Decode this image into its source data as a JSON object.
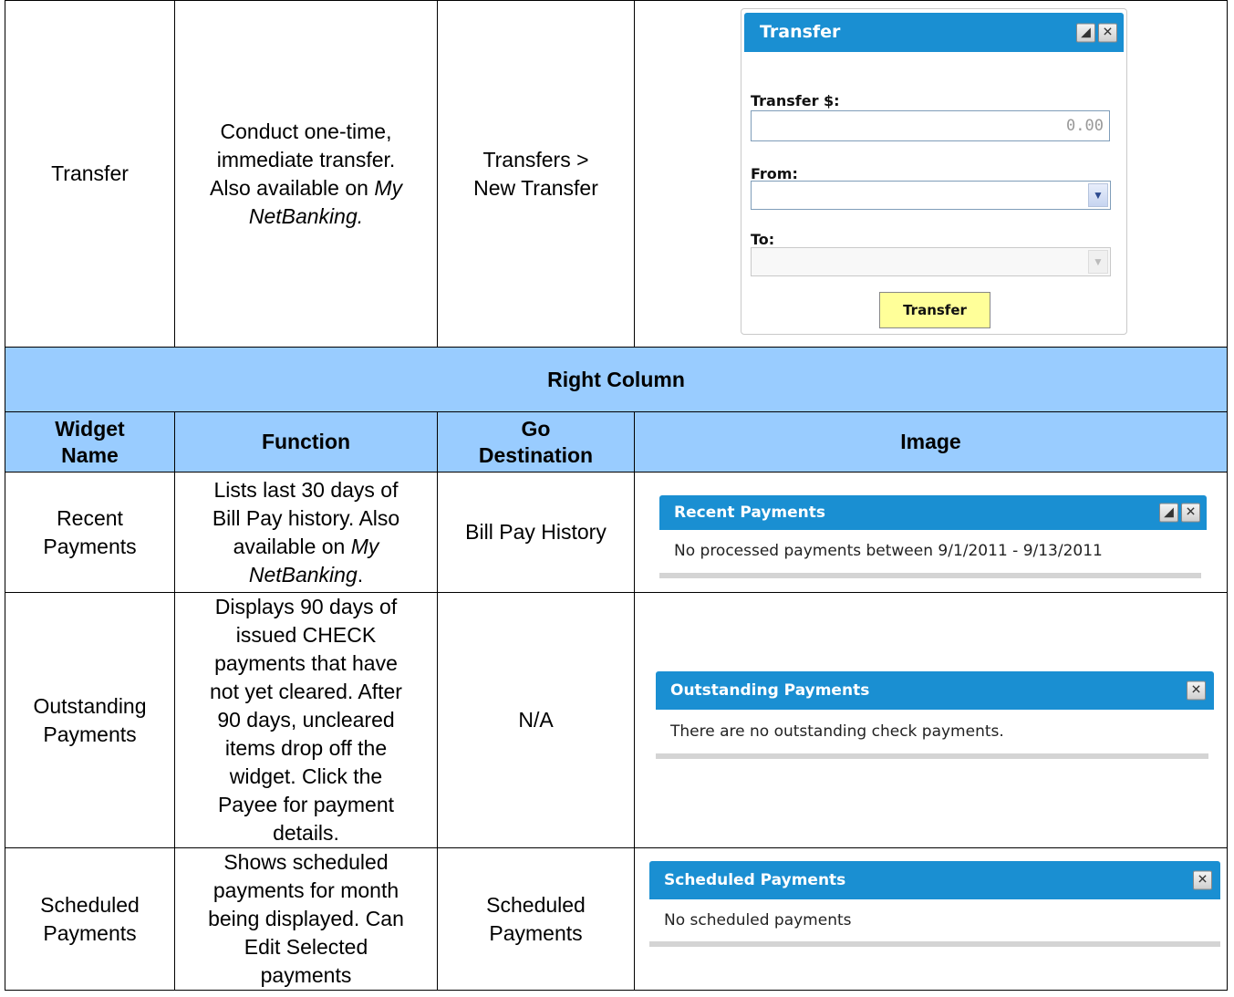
{
  "transfer_row": {
    "name": "Transfer",
    "function_line1": "Conduct one-time,",
    "function_line2": "immediate transfer.",
    "function_line3_pre": "Also available on ",
    "function_line3_em": "My",
    "function_line4_em": "NetBanking.",
    "destination_line1": "Transfers >",
    "destination_line2": "New Transfer",
    "widget": {
      "title": "Transfer",
      "amount_label": "Transfer $:",
      "amount_value": "0.00",
      "from_label": "From:",
      "to_label": "To:",
      "button_label": "Transfer"
    }
  },
  "section_header": "Right Column",
  "column_headers": {
    "widget_name_1": "Widget",
    "widget_name_2": "Name",
    "function": "Function",
    "destination_1": "Go",
    "destination_2": "Destination",
    "image": "Image"
  },
  "rows": [
    {
      "name_1": "Recent",
      "name_2": "Payments",
      "function_lines": [
        "Lists last 30 days of",
        "Bill Pay history. Also",
        "available on "
      ],
      "function_em_1": "My",
      "function_em_2": "NetBanking",
      "function_tail": ".",
      "destination": "Bill Pay History",
      "widget_title": "Recent Payments",
      "widget_body": "No processed payments between 9/1/2011 - 9/13/2011"
    },
    {
      "name_1": "Outstanding",
      "name_2": "Payments",
      "function_lines": [
        "Displays 90 days of",
        "issued CHECK",
        "payments that have",
        "not yet cleared. After",
        "90 days, uncleared",
        "items drop off the",
        "widget. Click the",
        "Payee for payment",
        "details."
      ],
      "destination": "N/A",
      "widget_title": "Outstanding Payments",
      "widget_body": "There are no outstanding check payments."
    },
    {
      "name_1": "Scheduled",
      "name_2": "Payments",
      "function_lines": [
        "Shows scheduled",
        "payments for month",
        "being displayed. Can",
        "Edit Selected",
        "payments"
      ],
      "destination_1": "Scheduled",
      "destination_2": "Payments",
      "widget_title": "Scheduled Payments",
      "widget_body": "No scheduled payments"
    }
  ],
  "icons": {
    "restore": "restore-icon",
    "close": "close-icon",
    "dropdown": "chevron-down-icon"
  },
  "colors": {
    "header_band": "#99ccff",
    "widget_title_bar": "#1a8fd2",
    "transfer_button": "#ffff99"
  }
}
